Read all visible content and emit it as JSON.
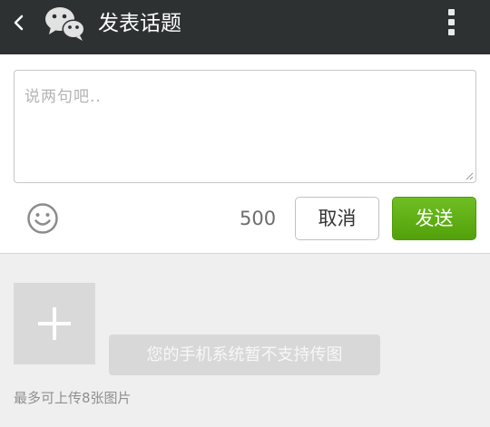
{
  "header": {
    "title": "发表话题",
    "back_icon": "chevron-left-icon",
    "logo_icon": "wechat-logo-icon",
    "menu_icon": "more-vertical-icon"
  },
  "composer": {
    "placeholder": "说两句吧..",
    "char_count": "500",
    "emoji_icon": "smiley-icon",
    "cancel_label": "取消",
    "send_label": "发送"
  },
  "images": {
    "add_icon": "plus-icon",
    "unsupported_text": "您的手机系统暂不支持传图",
    "limit_text": "最多可上传8张图片"
  },
  "colors": {
    "header_bg": "#2d3132",
    "send_green": "#5aaa14",
    "page_bg": "#efefef"
  }
}
